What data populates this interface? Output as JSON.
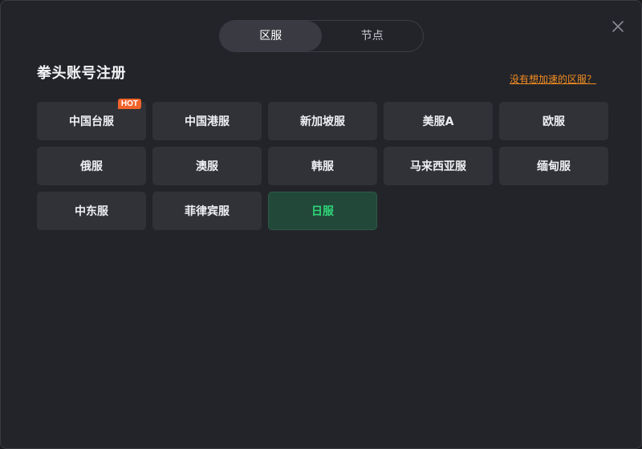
{
  "tabs": [
    {
      "label": "区服",
      "active": true
    },
    {
      "label": "节点",
      "active": false
    }
  ],
  "close_icon": "close-icon",
  "title": "拳头账号注册",
  "help_link": "没有想加速的区服？",
  "colors": {
    "accent_link": "#f08c22",
    "hot_badge": "#f0642c",
    "selected_text": "#2fd678",
    "selected_bg": "#22483a"
  },
  "regions": [
    {
      "label": "中国台服",
      "badge": "HOT"
    },
    {
      "label": "中国港服"
    },
    {
      "label": "新加坡服"
    },
    {
      "label": "美服A"
    },
    {
      "label": "欧服"
    },
    {
      "label": "俄服"
    },
    {
      "label": "澳服"
    },
    {
      "label": "韩服"
    },
    {
      "label": "马来西亚服"
    },
    {
      "label": "缅甸服"
    },
    {
      "label": "中东服"
    },
    {
      "label": "菲律宾服"
    },
    {
      "label": "日服",
      "selected": true
    }
  ]
}
